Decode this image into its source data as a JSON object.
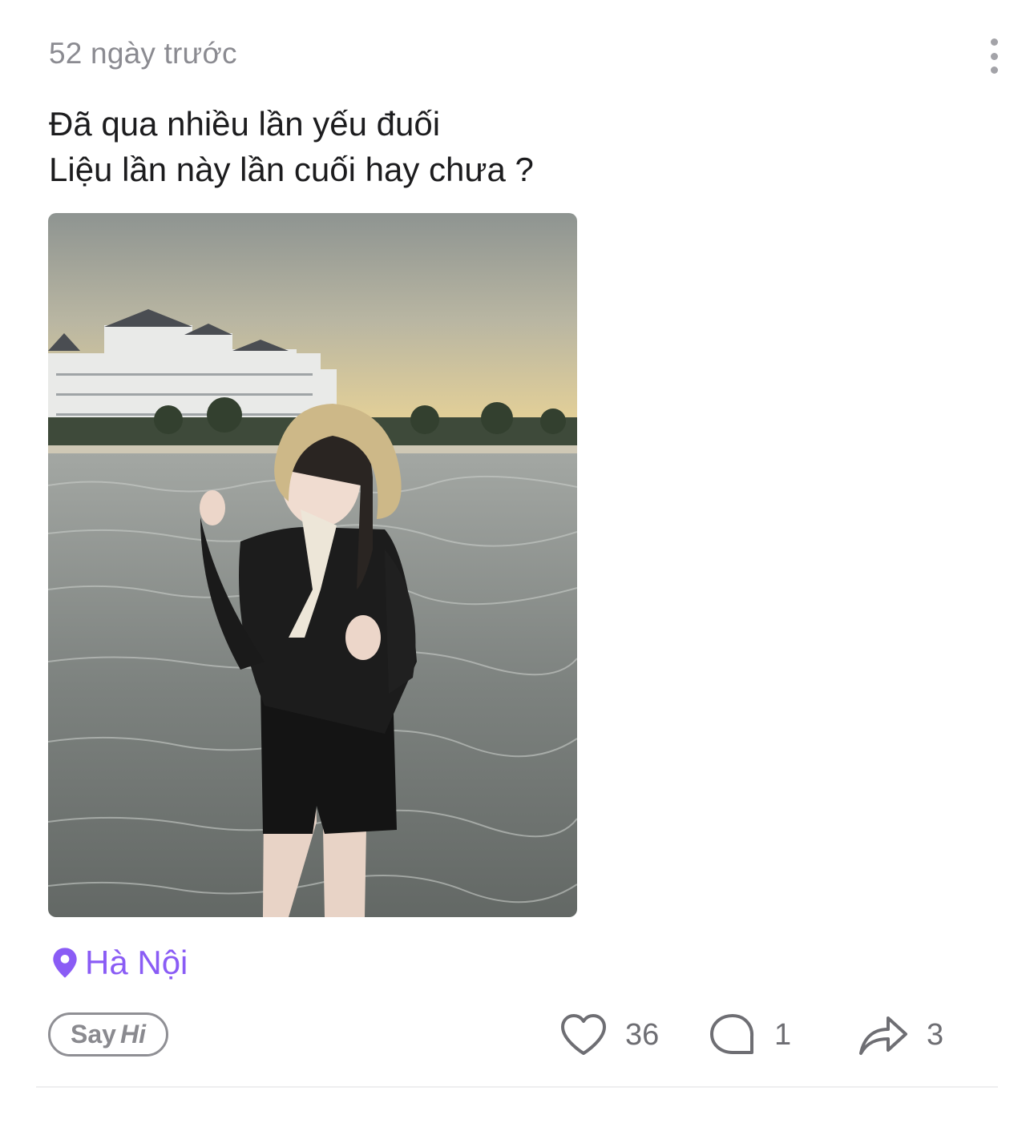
{
  "post": {
    "timestamp": "52 ngày trước",
    "caption_lines": [
      "Đã qua nhiều lần yếu đuối",
      "Liệu lần này lần cuối hay chưa ?"
    ],
    "photo": {
      "description_icon": "photo"
    },
    "location": {
      "icon": "map-pin-icon",
      "text": "Hà Nội"
    },
    "say_hi": {
      "say": "Say",
      "hi": "Hi"
    },
    "actions": {
      "likes": "36",
      "comments": "1",
      "shares": "3"
    }
  },
  "colors": {
    "accent": "#8a5cf5",
    "muted_text": "#8b8b91",
    "primary_text": "#1c1c1e",
    "icon_gray": "#6e6e73"
  }
}
